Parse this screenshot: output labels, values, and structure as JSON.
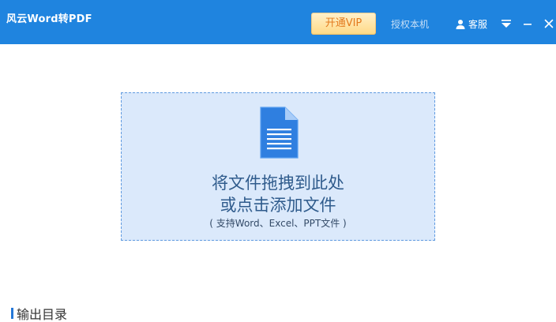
{
  "app": {
    "title": "风云Word转PDF"
  },
  "titlebar": {
    "background_color": "#1f84df",
    "vip_button_label": "开通VIP",
    "authorize_label": "授权本机",
    "service_label": "客服",
    "menu_icon": "triangle-down-icon",
    "minimize_icon": "minimize-icon",
    "close_icon": "close-icon"
  },
  "dropzone": {
    "line1": "将文件拖拽到此处",
    "line2": "或点击添加文件",
    "hint": "( 支持Word、Excel、PPT文件 )",
    "background_color": "#dbe9fb",
    "border_color": "#5f9ae0",
    "icon": "document-icon"
  },
  "output": {
    "label": "输出目录"
  },
  "colors": {
    "accent": "#1f84df",
    "vip_text": "#e37a1d"
  }
}
